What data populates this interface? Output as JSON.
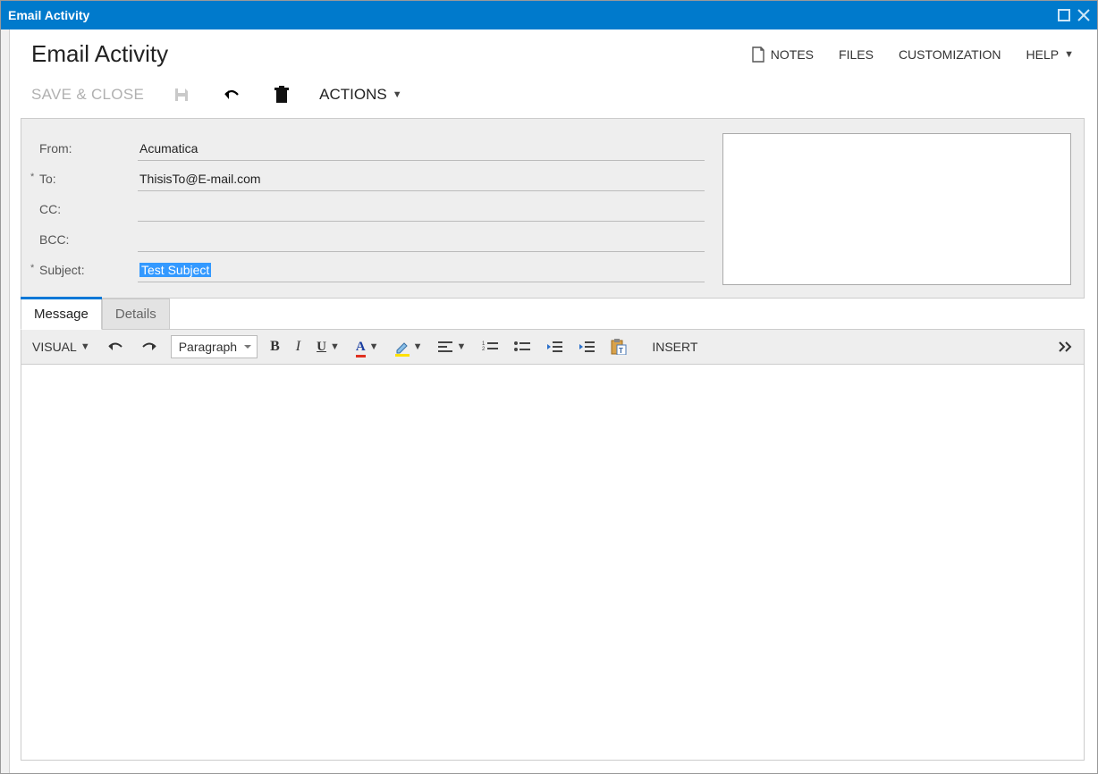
{
  "window": {
    "title": "Email Activity"
  },
  "page": {
    "title": "Email Activity"
  },
  "header_actions": {
    "notes": "NOTES",
    "files": "FILES",
    "customization": "CUSTOMIZATION",
    "help": "HELP"
  },
  "toolbar": {
    "save_close": "SAVE & CLOSE",
    "actions": "ACTIONS"
  },
  "form": {
    "labels": {
      "from": "From:",
      "to": "To:",
      "cc": "CC:",
      "bcc": "BCC:",
      "subject": "Subject:"
    },
    "values": {
      "from": "Acumatica",
      "to": "ThisisTo@E-mail.com",
      "cc": "",
      "bcc": "",
      "subject": "Test Subject"
    }
  },
  "tabs": {
    "message": "Message",
    "details": "Details"
  },
  "editor": {
    "visual": "VISUAL",
    "paragraph": "Paragraph",
    "insert": "INSERT"
  }
}
